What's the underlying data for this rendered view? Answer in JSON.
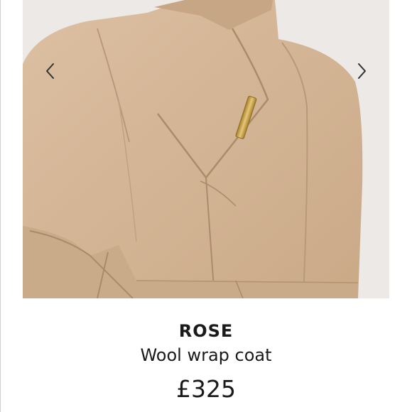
{
  "carousel": {
    "prev_icon": "chevron-left-icon",
    "next_icon": "chevron-right-icon",
    "image_subject": "camel wool wrap coat with stand collar, gold bar clasp and tie belt"
  },
  "product": {
    "brand": "ROSE",
    "name": "Wool wrap coat",
    "price": "£325"
  },
  "colors": {
    "coat": "#d4b595",
    "coat_shadow": "#b8997a",
    "backdrop": "#ece9e6",
    "clasp": "#c9a24a",
    "text": "#1a1a1a",
    "arrow": "#333333"
  }
}
